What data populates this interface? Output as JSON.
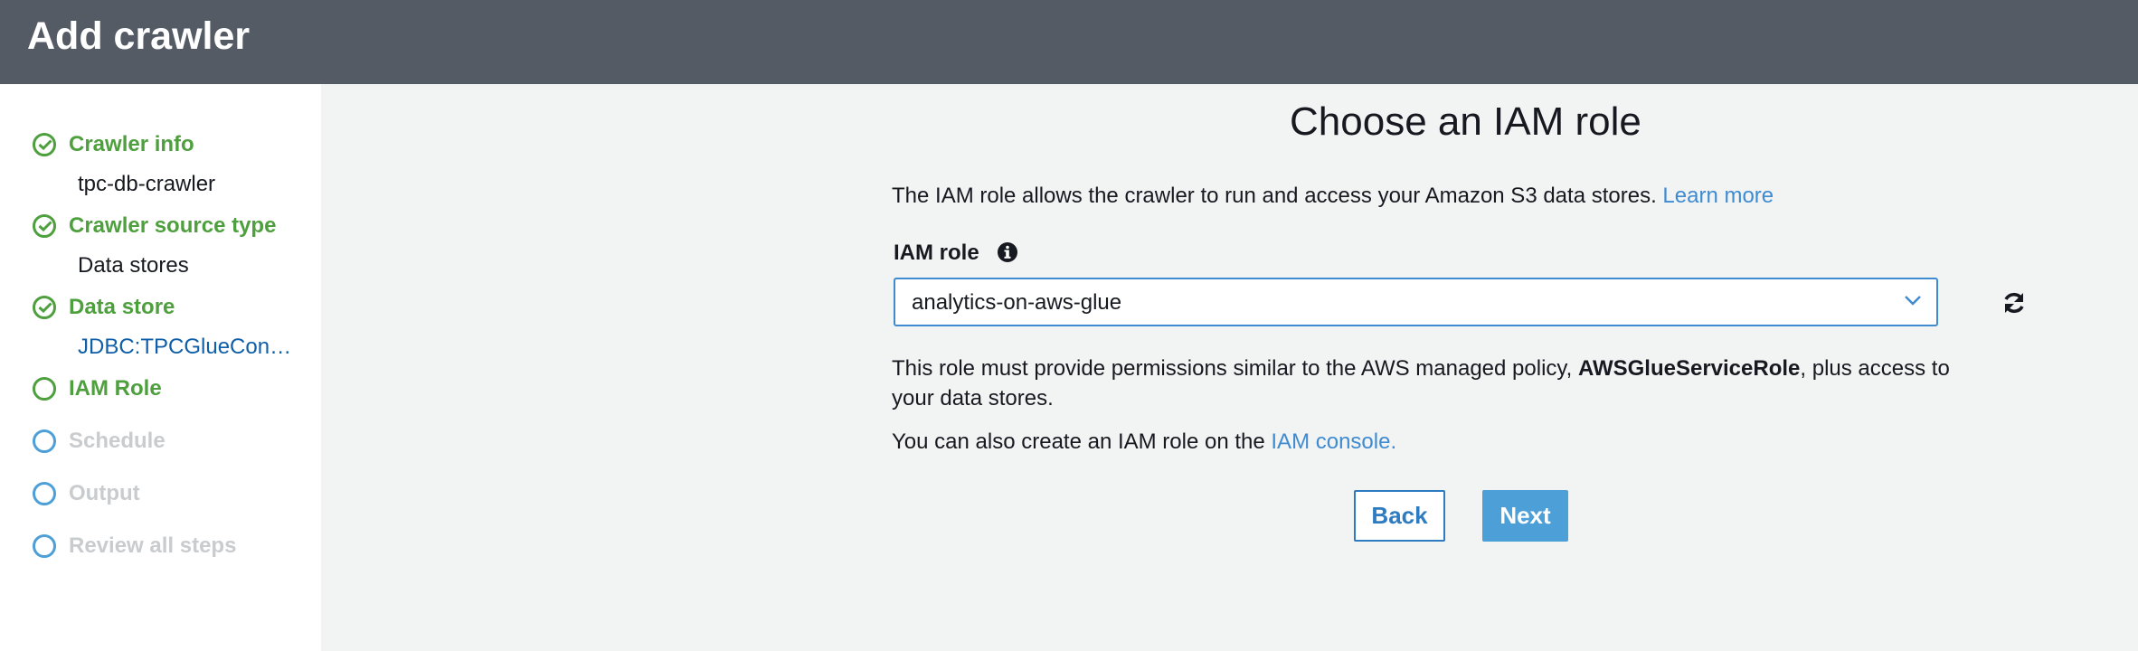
{
  "header": {
    "title": "Add crawler"
  },
  "steps": [
    {
      "label": "Crawler info",
      "status": "complete",
      "sub": "tpc-db-crawler"
    },
    {
      "label": "Crawler source type",
      "status": "complete",
      "sub": "Data stores"
    },
    {
      "label": "Data store",
      "status": "complete",
      "sub": "JDBC:TPCGlueCon…"
    },
    {
      "label": "IAM Role",
      "status": "current"
    },
    {
      "label": "Schedule",
      "status": "pending"
    },
    {
      "label": "Output",
      "status": "pending"
    },
    {
      "label": "Review all steps",
      "status": "pending"
    }
  ],
  "main": {
    "title": "Choose an IAM role",
    "intro": "The IAM role allows the crawler to run and access your Amazon S3 data stores.",
    "learn_more": "Learn more",
    "field_label": "IAM role",
    "selected_role": "analytics-on-aws-glue",
    "policy_line1_prefix": "This role must provide permissions similar to the AWS managed policy, ",
    "policy_name": "AWSGlueServiceRole",
    "policy_line1_suffix": ", plus access to",
    "policy_line2": "your data stores.",
    "console_prefix": "You can also create an IAM role on the ",
    "console_link": "IAM console.",
    "back_label": "Back",
    "next_label": "Next"
  },
  "colors": {
    "header_bg": "#545b64",
    "complete_green": "#4e9f3d",
    "link_blue": "#3f8bd1",
    "primary_button": "#4d9fd7",
    "pending_gray": "#c9cccf"
  }
}
